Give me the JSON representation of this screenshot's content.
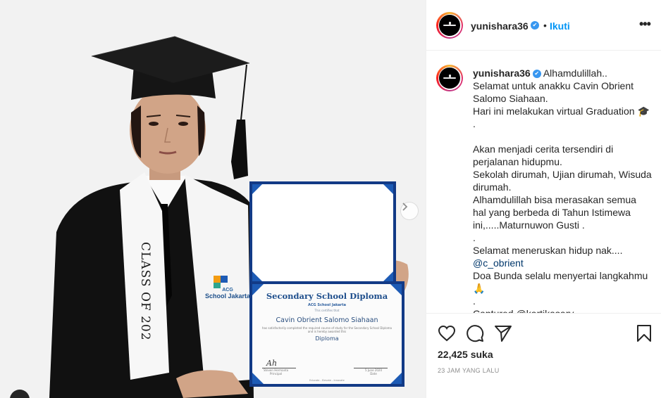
{
  "post": {
    "username": "yunishara36",
    "verified_badge": "✔",
    "follow_label": "Ikuti",
    "more_label": "•••",
    "separator": "•"
  },
  "photo": {
    "next_icon": "chevron-right-icon",
    "certificate": {
      "title": "Secondary School Diploma",
      "school": "ACG School Jakarta",
      "subtitle": "This certifies that",
      "student": "Cavin Obrient Salomo Siahaan",
      "body": "has satisfactorily completed the required course of study for the Secondary School Diploma and is hereby awarded this",
      "award": "Diploma",
      "signer_label": "Principal",
      "date_label": "Date",
      "date": "5 June 2020",
      "signer_name": "Steven Hermanto",
      "footer": "Educate - Elevate - Innovate"
    },
    "scarf_text": "CLASS OF 202",
    "logo": {
      "acg": "ACG",
      "school": "School Jakarta"
    }
  },
  "caption": {
    "username": "yunishara36",
    "lines": [
      "Alhamdulillah..",
      "Selamat untuk anakku Cavin Obrient Salomo Siahaan.",
      "Hari ini melakukan virtual Graduation 🎓 .",
      "",
      "Akan menjadi cerita tersendiri di perjalanan hidupmu.",
      "Sekolah dirumah, Ujian dirumah, Wisuda dirumah.",
      "Alhamdulillah bisa merasakan semua hal yang berbeda di Tahun Istimewa ini,.....Maturnuwon Gusti .",
      ".",
      "Selamat meneruskan hidup nak....",
      "@c_obrient",
      "Doa Bunda selalu menyertai langkahmu 🙏",
      ".",
      "Captured @kartikasary"
    ]
  },
  "actions": {
    "like_icon": "heart-icon",
    "comment_icon": "comment-icon",
    "share_icon": "share-icon",
    "save_icon": "bookmark-icon",
    "likes": "22,425 suka",
    "time": "23 JAM YANG LALU"
  },
  "colors": {
    "link_blue": "#0095f6",
    "verified_blue": "#3897f0",
    "text": "#262626",
    "muted": "#8e8e8e"
  }
}
